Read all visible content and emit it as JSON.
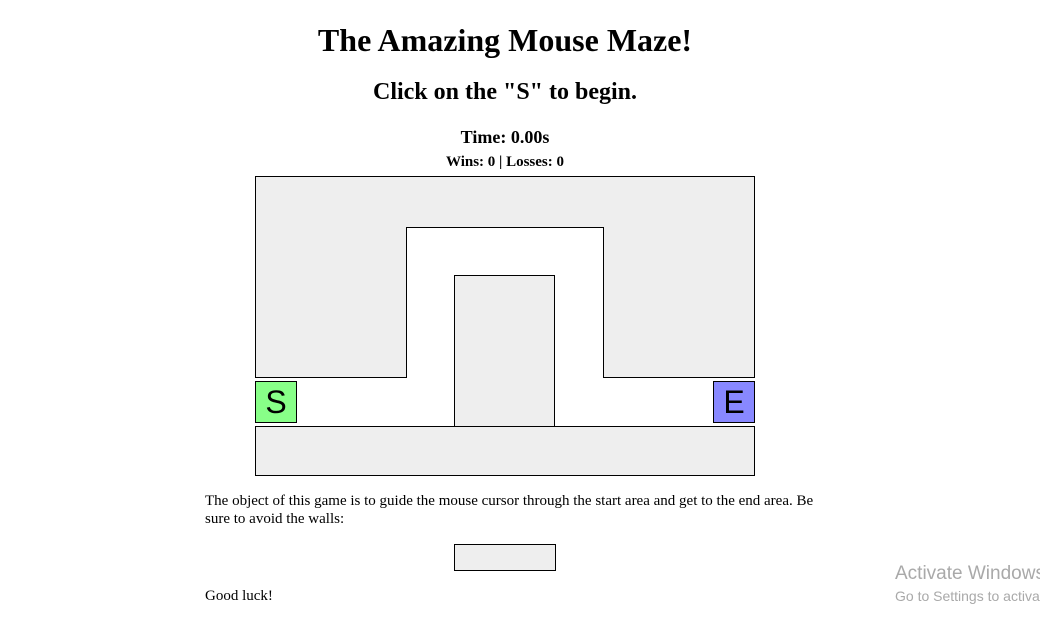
{
  "header": {
    "title": "The Amazing Mouse Maze!",
    "subtitle": "Click on the \"S\" to begin."
  },
  "status": {
    "time_text": "Time: 0.00s",
    "score_text": "Wins: 0 | Losses: 0"
  },
  "maze": {
    "start_label": "S",
    "end_label": "E",
    "start_color": "#88ff88",
    "end_color": "#8888ff",
    "wall_color": "#eeeeee"
  },
  "instructions": {
    "text": "The object of this game is to guide the mouse cursor through the start area and get to the end area. Be sure to avoid the walls:",
    "closing": "Good luck!"
  },
  "watermark": {
    "line1": "Activate Windows",
    "line2": "Go to Settings to activate Windows."
  }
}
